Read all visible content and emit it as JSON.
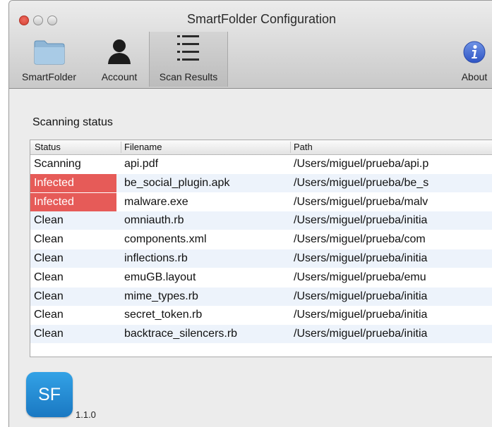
{
  "window": {
    "title": "SmartFolder Configuration"
  },
  "toolbar": {
    "items": [
      {
        "label": "SmartFolder",
        "icon": "folder-icon"
      },
      {
        "label": "Account",
        "icon": "user-icon"
      },
      {
        "label": "Scan Results",
        "icon": "list-icon",
        "active": true
      },
      {
        "label": "About",
        "icon": "info-icon"
      }
    ]
  },
  "main": {
    "section_title": "Scanning status",
    "columns": [
      "Status",
      "Filename",
      "Path"
    ],
    "rows": [
      {
        "status": "Scanning",
        "filename": "api.pdf",
        "path": "/Users/miguel/prueba/api.p"
      },
      {
        "status": "Infected",
        "filename": "be_social_plugin.apk",
        "path": "/Users/miguel/prueba/be_s"
      },
      {
        "status": "Infected",
        "filename": "malware.exe",
        "path": "/Users/miguel/prueba/malv"
      },
      {
        "status": "Clean",
        "filename": "omniauth.rb",
        "path": "/Users/miguel/prueba/initia"
      },
      {
        "status": "Clean",
        "filename": "components.xml",
        "path": "/Users/miguel/prueba/com"
      },
      {
        "status": "Clean",
        "filename": "inflections.rb",
        "path": "/Users/miguel/prueba/initia"
      },
      {
        "status": "Clean",
        "filename": "emuGB.layout",
        "path": "/Users/miguel/prueba/emu"
      },
      {
        "status": "Clean",
        "filename": "mime_types.rb",
        "path": "/Users/miguel/prueba/initia"
      },
      {
        "status": "Clean",
        "filename": "secret_token.rb",
        "path": "/Users/miguel/prueba/initia"
      },
      {
        "status": "Clean",
        "filename": "backtrace_silencers.rb",
        "path": "/Users/miguel/prueba/initia"
      }
    ]
  },
  "footer": {
    "app_icon_text": "SF",
    "version": "1.1.0"
  },
  "colors": {
    "infected": "#e65b58",
    "accent": "#1a78c2",
    "alt_row": "#edf3fb"
  }
}
